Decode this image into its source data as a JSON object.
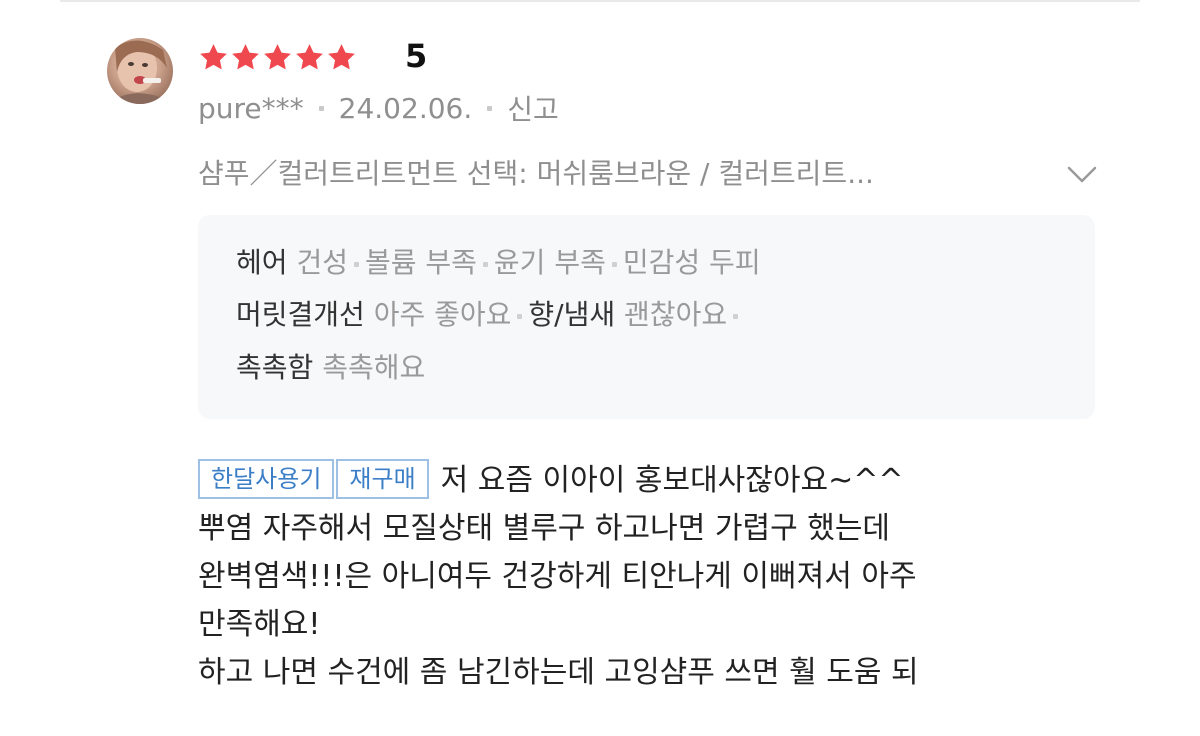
{
  "review": {
    "rating": "5",
    "stars_filled": 5,
    "stars_total": 5,
    "star_color": "#f0484f",
    "username": "pure***",
    "date": "24.02.06.",
    "report_label": "신고",
    "option": "샴푸／컬러트리트먼트 선택: 머쉬룸브라운 / 컬러트리트...",
    "attributes": {
      "hair_label": "헤어",
      "hair_values": [
        "건성",
        "볼륨 부족",
        "윤기 부족",
        "민감성 두피"
      ],
      "improvement_label": "머릿결개선",
      "improvement_value": "아주 좋아요",
      "scent_label": "향/냄새",
      "scent_value": "괜찮아요",
      "moisture_label": "촉촉함",
      "moisture_value": "촉촉해요"
    },
    "badges": [
      "한달사용기",
      "재구매"
    ],
    "body_lines": [
      "저 요즘 이아이 홍보대사잖아요~^^",
      "뿌염 자주해서 모질상태 별루구 하고나면 가렵구 했는데",
      "완벽염색!!!은 아니여두 건강하게 티안나게 이뻐져서 아주",
      "만족해요!",
      "하고 나면 수건에 좀 남긴하는데 고잉샴푸 쓰면 훨 도움 되"
    ]
  }
}
